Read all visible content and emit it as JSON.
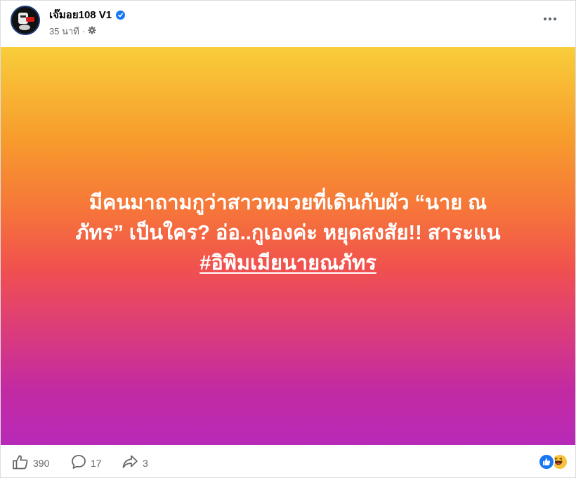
{
  "post": {
    "author": "เจ๊มอย108 V1",
    "time": "35 นาที",
    "separator": "·",
    "text_line1": "มีคนมาถามกูว่าสาวหมวยที่เดินกับผัว “นาย ณ",
    "text_line2": "ภัทร” เป็นใคร? อ่อ..กูเองค่ะ หยุดสงสัย!! สาระแน",
    "hashtag": "#อิพิมเมียนายณภัทร"
  },
  "stats": {
    "likes": "390",
    "comments": "17",
    "shares": "3"
  },
  "icons": {
    "verified": "verified-badge-icon",
    "audience": "gear-icon",
    "more": "more-options-icon",
    "like": "thumbs-up-icon",
    "comment": "comment-bubble-icon",
    "share": "share-arrow-icon",
    "reaction_like": "like-reaction-icon",
    "reaction_haha": "haha-reaction-icon"
  },
  "colors": {
    "gradient_top": "#f8cd3a",
    "gradient_middle": "#f0504f",
    "gradient_bottom": "#b72ab8",
    "accent": "#1877f2"
  }
}
